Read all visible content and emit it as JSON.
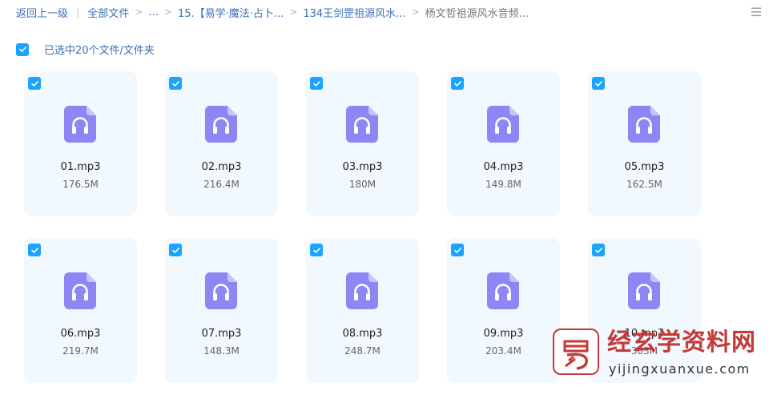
{
  "breadcrumb": {
    "back": "返回上一级",
    "all_files": "全部文件",
    "ellipsis": "...",
    "folder1": "15.【易学·魔法·占卜...",
    "folder2": "134王剑罡祖源风水...",
    "current": "杨文哲祖源风水音频..."
  },
  "selection": {
    "label": "已选中20个文件/文件夹"
  },
  "files": [
    {
      "name": "01.mp3",
      "size": "176.5M",
      "checked": true
    },
    {
      "name": "02.mp3",
      "size": "216.4M",
      "checked": true
    },
    {
      "name": "03.mp3",
      "size": "180M",
      "checked": true
    },
    {
      "name": "04.mp3",
      "size": "149.8M",
      "checked": true
    },
    {
      "name": "05.mp3",
      "size": "162.5M",
      "checked": true
    },
    {
      "name": "06.mp3",
      "size": "219.7M",
      "checked": true
    },
    {
      "name": "07.mp3",
      "size": "148.3M",
      "checked": true
    },
    {
      "name": "08.mp3",
      "size": "248.7M",
      "checked": true
    },
    {
      "name": "09.mp3",
      "size": "203.4M",
      "checked": true
    },
    {
      "name": "10.mp3",
      "size": "303M",
      "checked": true
    }
  ],
  "icons": {
    "file": "audio-file-icon",
    "check": "checkmark-icon",
    "view": "list-view-icon"
  },
  "colors": {
    "accent": "#1aa3ff",
    "link": "#3b6fb6",
    "card_bg": "#f1f8fe",
    "audio_icon": "#8f86f5",
    "watermark": "#c43a3a"
  },
  "watermark": {
    "title": "经玄学资料网",
    "url": "yijingxuanxue.com"
  }
}
